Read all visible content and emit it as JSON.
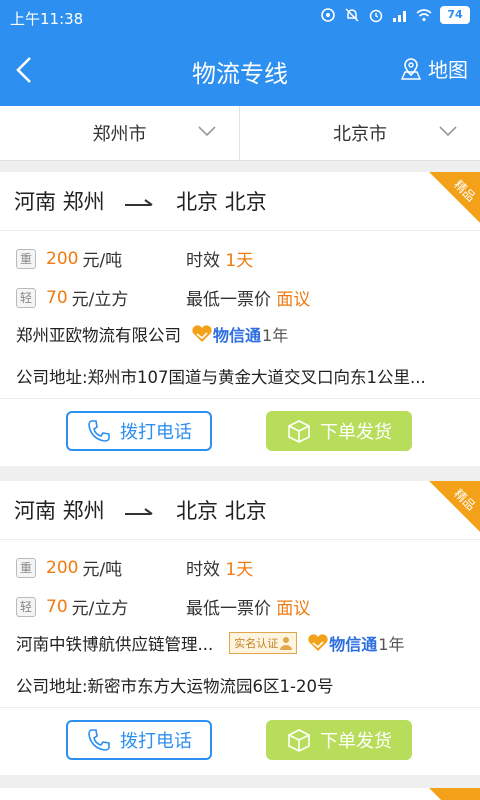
{
  "status_bar": {
    "time": "上午11:38",
    "battery": "74"
  },
  "nav": {
    "title": "物流专线",
    "map_label": "地图"
  },
  "filters": {
    "from_city": "郑州市",
    "to_city": "北京市"
  },
  "colors": {
    "brand": "#2d8ff0",
    "accent_orange": "#f07a10",
    "order_green": "#b8dd5b",
    "ribbon": "#f4a11a"
  },
  "listings": [
    {
      "ribbon": "精品",
      "from": "河南 郑州",
      "to": "北京 北京",
      "heavy_tag": "重",
      "heavy_price": "200",
      "heavy_unit": "元/吨",
      "light_tag": "轻",
      "light_price": "70",
      "light_unit": "元/立方",
      "time_label": "时效",
      "time_value": "1天",
      "min_label": "最低一票价",
      "min_value": "面议",
      "company": "郑州亚欧物流有限公司",
      "badge_wt": "物信通",
      "badge_years": "1年",
      "address": "公司地址:郑州市107国道与黄金大道交叉口向东1公里...",
      "call_label": "拨打电话",
      "order_label": "下单发货"
    },
    {
      "ribbon": "精品",
      "from": "河南 郑州",
      "to": "北京 北京",
      "heavy_tag": "重",
      "heavy_price": "200",
      "heavy_unit": "元/吨",
      "light_tag": "轻",
      "light_price": "70",
      "light_unit": "元/立方",
      "time_label": "时效",
      "time_value": "1天",
      "min_label": "最低一票价",
      "min_value": "面议",
      "company": "河南中铁博航供应链管理...",
      "badge_smrz": "实名认证",
      "badge_wt": "物信通",
      "badge_years": "1年",
      "address": "公司地址:新密市东方大运物流园6区1-20号",
      "call_label": "拨打电话",
      "order_label": "下单发货"
    }
  ]
}
